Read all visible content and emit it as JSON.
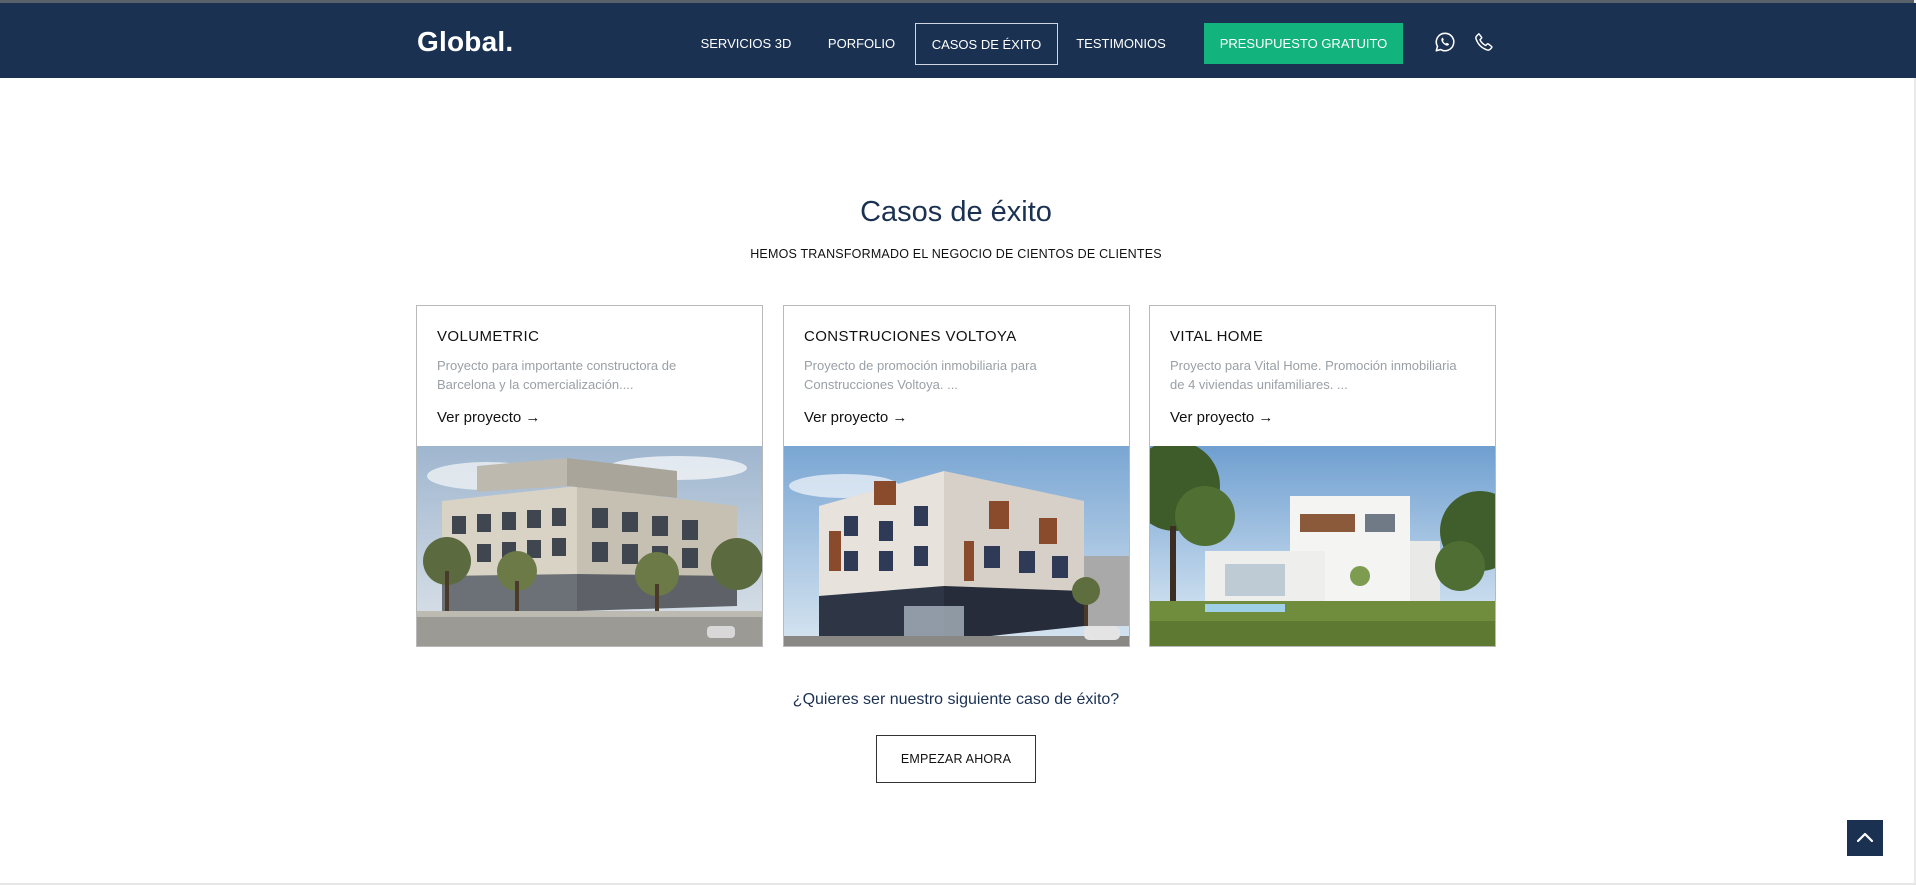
{
  "header": {
    "logo": "Global.",
    "nav": [
      {
        "label": "SERVICIOS 3D"
      },
      {
        "label": "PORFOLIO"
      },
      {
        "label": "CASOS DE ÉXITO"
      },
      {
        "label": "TESTIMONIOS"
      }
    ],
    "active_nav": "CASOS DE ÉXITO",
    "cta": "PRESUPUESTO GRATUITO",
    "icons": [
      "whatsapp-icon",
      "phone-icon"
    ]
  },
  "section": {
    "title": "Casos de éxito",
    "subtitle": "HEMOS TRANSFORMADO EL NEGOCIO DE CIENTOS DE CLIENTES"
  },
  "cards": [
    {
      "name": "VOLUMETRIC",
      "description": "Proyecto para importante constructora de Barcelona y la comercialización....",
      "link": "Ver proyecto →"
    },
    {
      "name": "CONSTRUCIONES VOLTOYA",
      "description": "Proyecto de promoción inmobiliaria para Construcciones Voltoya. ...",
      "link": "Ver proyecto →"
    },
    {
      "name": "VITAL HOME",
      "description": "Proyecto para Vital Home. Promoción inmobiliaria de 4 viviendas unifamiliares. ...",
      "link": "Ver proyecto →"
    }
  ],
  "cta": {
    "question": "¿Quieres ser nuestro siguiente caso de éxito?",
    "button": "EMPEZAR AHORA"
  },
  "colors": {
    "navy": "#1b3152",
    "green": "#12b37c",
    "muted_text": "#9aa0a6"
  }
}
